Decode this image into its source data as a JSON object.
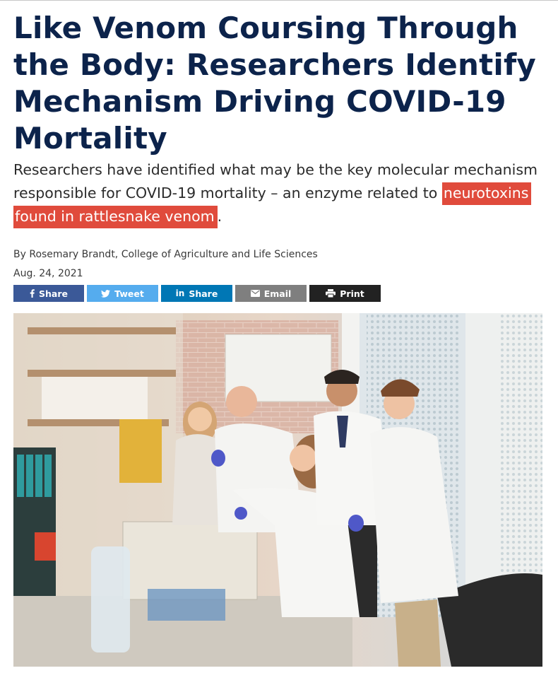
{
  "article": {
    "title": "Like Venom Coursing Through the Body: Researchers Identify Mechanism Driving COVID-19 Mortality",
    "dek_before": "Researchers have identified what may be the key molecular mechanism responsible for COVID-19 mortality – an enzyme related to ",
    "dek_highlight": "neurotoxins found in rattlesnake venom",
    "dek_after": ".",
    "byline": "By Rosemary Brandt, College of Agriculture and Life Sciences",
    "date": "Aug. 24, 2021"
  },
  "share": {
    "facebook": {
      "label": "Share",
      "icon": "facebook-icon",
      "color": "#3b5998"
    },
    "twitter": {
      "label": "Tweet",
      "icon": "twitter-icon",
      "color": "#55acee"
    },
    "linkedin": {
      "label": "Share",
      "icon": "linkedin-icon",
      "color": "#0077b5"
    },
    "email": {
      "label": "Email",
      "icon": "envelope-icon",
      "color": "#7f7f7f"
    },
    "print": {
      "label": "Print",
      "icon": "printer-icon",
      "color": "#222222"
    }
  },
  "colors": {
    "title": "#0c234b",
    "highlight": "#e04b3c"
  }
}
